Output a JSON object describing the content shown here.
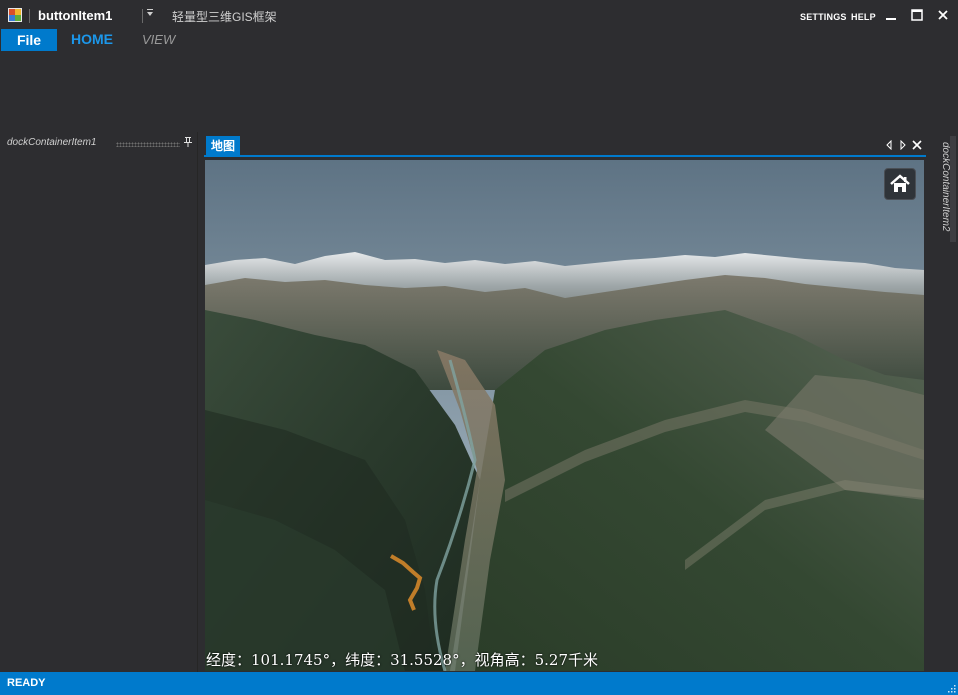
{
  "titlebar": {
    "qat_item_label": "buttonItem1",
    "window_title": "轻量型三维GIS框架",
    "settings_label": "SETTINGS",
    "help_label": "HELP"
  },
  "ribbon": {
    "tabs": [
      {
        "label": "File"
      },
      {
        "label": "HOME"
      },
      {
        "label": "VIEW"
      }
    ]
  },
  "left_dock": {
    "caption": "dockContainerItem1"
  },
  "document": {
    "tab_label": "地图",
    "coordinate_readout": "经度：101.1745°，纬度：31.5528°，视角高：5.27千米"
  },
  "right_dock": {
    "caption": "dockContainerItem2"
  },
  "status": {
    "text": "READY"
  },
  "icons": {
    "app": "app-icon",
    "qat_dropdown": "chevron-down-icon",
    "minimize": "minimize-icon",
    "maximize": "maximize-icon",
    "close": "close-icon",
    "pin": "pin-icon",
    "tab_prev": "triangle-left-icon",
    "tab_next": "triangle-right-icon",
    "tab_close": "close-icon",
    "home": "home-icon"
  },
  "colors": {
    "accent": "#007acc",
    "background": "#2d2d30",
    "home_tab": "#1c97ea"
  }
}
